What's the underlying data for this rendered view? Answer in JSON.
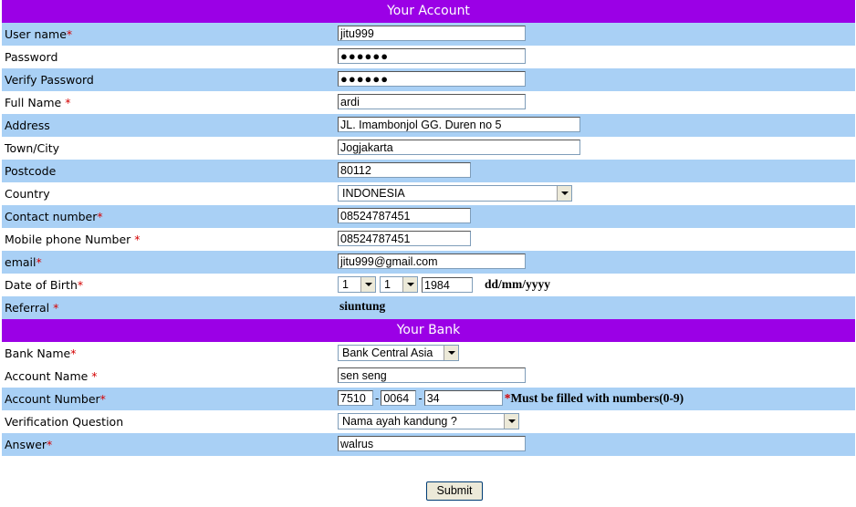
{
  "account": {
    "header": "Your Account",
    "rows": [
      {
        "label": "User name",
        "req": "*",
        "value": "jitu999"
      },
      {
        "label": "Password",
        "req": "",
        "value": "●●●●●●"
      },
      {
        "label": "Verify Password",
        "req": "",
        "value": "●●●●●●"
      },
      {
        "label": "Full Name ",
        "req": "*",
        "value": "ardi"
      },
      {
        "label": "Address",
        "req": "",
        "value": "JL. Imambonjol GG. Duren no 5"
      },
      {
        "label": "Town/City",
        "req": "",
        "value": "Jogjakarta"
      },
      {
        "label": "Postcode",
        "req": "",
        "value": "80112"
      },
      {
        "label": "Country",
        "req": "",
        "value": "INDONESIA"
      },
      {
        "label": "Contact number",
        "req": "*",
        "value": "08524787451"
      },
      {
        "label": "Mobile phone Number ",
        "req": "*",
        "value": "08524787451"
      },
      {
        "label": "email",
        "req": "*",
        "value": "jitu999@gmail.com"
      },
      {
        "label": "Date of Birth",
        "req": "*"
      },
      {
        "label": "Referral ",
        "req": "*",
        "value": "siuntung"
      }
    ],
    "dob": {
      "day": "1",
      "month": "1",
      "year": "1984",
      "format": "dd/mm/yyyy"
    }
  },
  "bank": {
    "header": "Your Bank",
    "rows": [
      {
        "label": "Bank Name",
        "req": "*",
        "value": "Bank Central Asia"
      },
      {
        "label": "Account Name ",
        "req": "*",
        "value": "sen seng"
      },
      {
        "label": "Account Number",
        "req": "*"
      },
      {
        "label": "Verification Question",
        "req": "",
        "value": "Nama ayah kandung ?"
      },
      {
        "label": "Answer",
        "req": "*",
        "value": "walrus"
      }
    ],
    "account_number": {
      "part1": "7510",
      "part2": "0064",
      "part3": "34",
      "dash": "-",
      "note_req": "*",
      "note": "Must be filled with numbers(0-9)"
    }
  },
  "submit_label": "Submit",
  "colors": {
    "header": "#9b00e6",
    "row_blue": "#a9d0f5",
    "required": "#d40000"
  }
}
